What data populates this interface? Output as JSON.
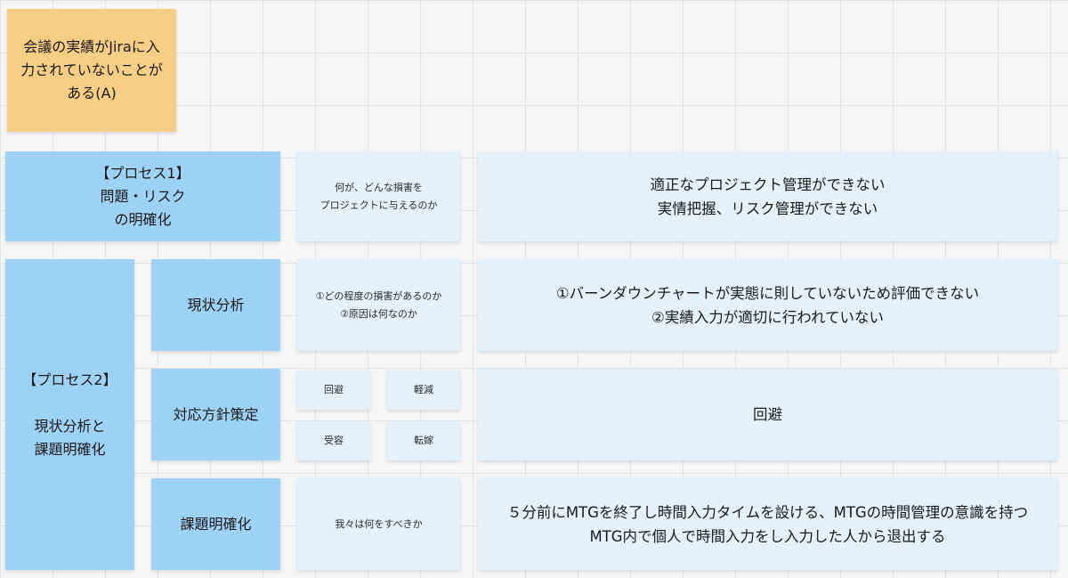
{
  "colors": {
    "orange_note": "#f8cd86",
    "blue_note": "#9dd1f5",
    "pale_note": "#e4f1fb"
  },
  "board": {
    "issue_note": "会議の実績がJiraに入\n力されていないことが\nある(A)",
    "process1": {
      "title": "【プロセス1】\n問題・リスク\nの明確化",
      "question": "何が、どんな損害を\nプロジェクトに与えるのか",
      "answer": "適正なプロジェクト管理ができない\n実情把握、リスク管理ができない"
    },
    "process2": {
      "title": "【プロセス2】\n\n現状分析と\n課題明確化",
      "rows": [
        {
          "label": "現状分析",
          "question": "①どの程度の損害があるのか\n②原因は何なのか",
          "answer": "①バーンダウンチャートが実態に則していないため評価できない\n②実績入力が適切に行われていない"
        },
        {
          "label": "対応方針策定",
          "options": [
            "回避",
            "軽減",
            "受容",
            "転嫁"
          ],
          "answer": "回避"
        },
        {
          "label": "課題明確化",
          "question": "我々は何をすべきか",
          "answer": "５分前にMTGを終了し時間入力タイムを設ける、MTGの時間管理の意識を持つ\nMTG内で個人で時間入力をし入力した人から退出する"
        }
      ]
    }
  }
}
